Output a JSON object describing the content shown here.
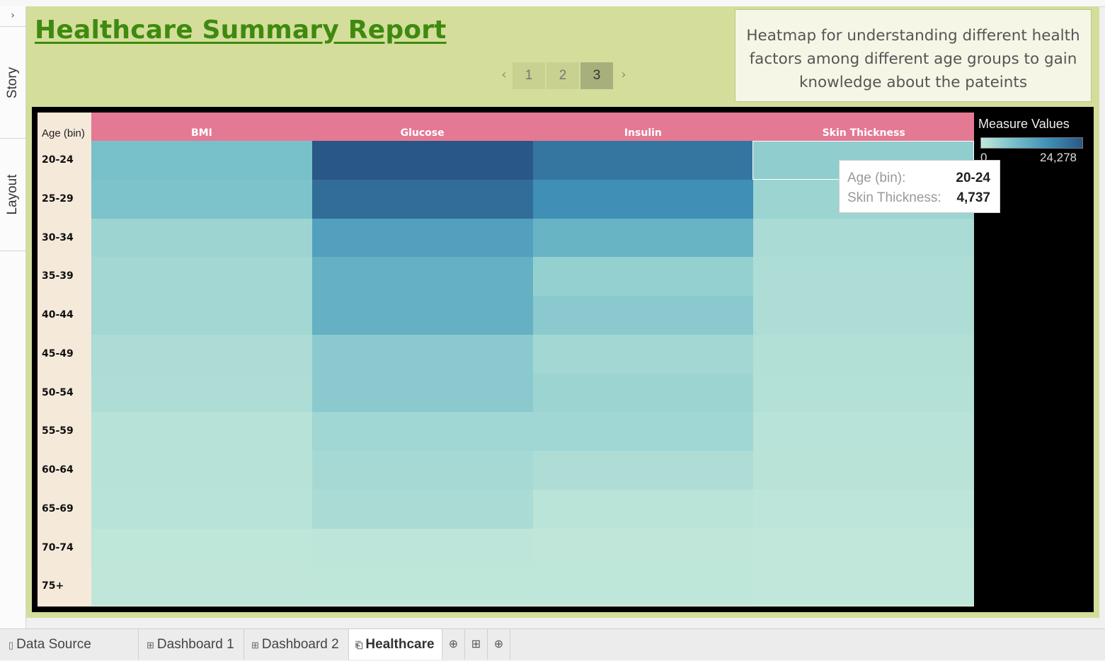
{
  "rail": {
    "collapse_icon": "chevron-right-icon",
    "story_label": "Story",
    "layout_label": "Layout"
  },
  "story": {
    "title": "Healthcare Summary Report",
    "caption": "Heatmap for understanding different health factors among different age groups to gain knowledge about the pateints",
    "pages": [
      "1",
      "2",
      "3"
    ],
    "active_page": "3",
    "prev_icon": "chevron-left-icon",
    "next_icon": "chevron-right-icon"
  },
  "legend": {
    "title": "Measure Values",
    "min_label": "0",
    "max_label": "24,278",
    "colors": [
      "#c2e8da",
      "#2a5886"
    ]
  },
  "tooltip": {
    "k1": "Age (bin):",
    "v1": "20-24",
    "k2": "Skin Thickness:",
    "v2": "4,737"
  },
  "chart_data": {
    "type": "heatmap",
    "row_header": "Age (bin)",
    "columns": [
      "BMI",
      "Glucose",
      "Insulin",
      "Skin Thickness"
    ],
    "rows": [
      "20-24",
      "25-29",
      "30-34",
      "35-39",
      "40-44",
      "45-49",
      "50-54",
      "55-59",
      "60-64",
      "65-69",
      "70-74",
      "75+"
    ],
    "color_range": [
      0,
      24278
    ],
    "values": [
      [
        7000,
        24278,
        19000,
        4737
      ],
      [
        6500,
        20500,
        14500,
        3600
      ],
      [
        3500,
        12000,
        9000,
        2300
      ],
      [
        3000,
        9500,
        4300,
        2000
      ],
      [
        3000,
        9500,
        5300,
        2000
      ],
      [
        2100,
        5300,
        3000,
        1500
      ],
      [
        1900,
        5300,
        3600,
        1400
      ],
      [
        1100,
        3200,
        3200,
        900
      ],
      [
        1000,
        2600,
        2000,
        800
      ],
      [
        900,
        2300,
        700,
        500
      ],
      [
        400,
        500,
        300,
        200
      ],
      [
        300,
        400,
        250,
        150
      ]
    ]
  },
  "tabs": [
    {
      "label": "Data Source",
      "icon": "datasource-icon",
      "glyph": "▯"
    },
    {
      "label": "Dashboard 1",
      "icon": "dashboard-icon",
      "glyph": "⊞"
    },
    {
      "label": "Dashboard 2",
      "icon": "dashboard-icon",
      "glyph": "⊞"
    },
    {
      "label": "Healthcare",
      "icon": "story-icon",
      "glyph": "⎗"
    }
  ],
  "tab_actions": [
    {
      "icon": "new-worksheet-icon",
      "glyph": "⊕"
    },
    {
      "icon": "new-dashboard-icon",
      "glyph": "⊞"
    },
    {
      "icon": "new-story-icon",
      "glyph": "⊕"
    }
  ]
}
